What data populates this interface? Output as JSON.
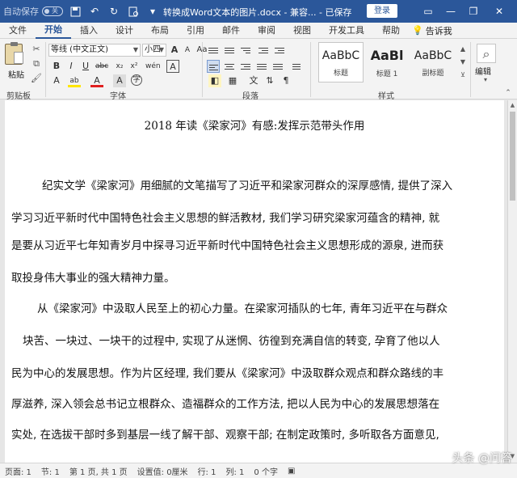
{
  "titlebar": {
    "autosave_label": "自动保存",
    "autosave_state": "关",
    "doc_title": "转换成Word文本的图片.docx  -  兼容...  -  已保存",
    "login_label": "登录",
    "minimize": "—",
    "restore": "❐",
    "close": "✕",
    "colors": {
      "bar": "#2b579a"
    }
  },
  "tabs": [
    "文件",
    "开始",
    "插入",
    "设计",
    "布局",
    "引用",
    "邮件",
    "审阅",
    "视图",
    "开发工具",
    "帮助"
  ],
  "tell_me": "告诉我",
  "ribbon": {
    "paste_label": "粘贴",
    "clipboard_label": "剪贴板",
    "font_name": "等线 (中文正文)",
    "font_size": "小四",
    "font_group_label": "字体",
    "paragraph_label": "段落",
    "styles_label": "样式",
    "edit_label": "编辑",
    "styles": [
      {
        "sample": "AaBbC",
        "name": "标题"
      },
      {
        "sample": "AaBl",
        "name": "标题 1"
      },
      {
        "sample": "AaBbC",
        "name": "副标题"
      }
    ],
    "font_buttons": {
      "bold": "B",
      "italic": "I",
      "underline": "U",
      "strike": "abc",
      "sub": "x₂",
      "sup": "x²",
      "font_color": "A",
      "highlight": "ab",
      "aa_grow": "A",
      "aa_shrink": "A",
      "case": "Aa",
      "phonetic": "wén",
      "border_char": "A"
    }
  },
  "document": {
    "title": "2018 年读《梁家河》有感:发挥示范带头作用",
    "lines": [
      "纪实文学《梁家河》用细腻的文笔描写了习近平和梁家河群众的深厚感情, 提供了深入",
      "学习习近平新时代中国特色社会主义思想的鲜活教材, 我们学习研究梁家河蕴含的精神, 就",
      "是要从习近平七年知青岁月中探寻习近平新时代中国特色社会主义思想形成的源泉, 进而获",
      "取投身伟大事业的强大精神力量。",
      "从《梁家河》中汲取人民至上的初心力量。在梁家河插队的七年, 青年习近平在与群众",
      "块苦、一块过、一块干的过程中, 实现了从迷惘、彷徨到充满自信的转变, 孕育了他以人",
      "民为中心的发展思想。作为片区经理, 我们要从《梁家河》中汲取群众观点和群众路线的丰",
      "厚滋养, 深入领会总书记立根群众、造福群众的工作方法, 把以人民为中心的发展思想落在",
      "实处, 在选拔干部时多到基层一线了解干部、观察干部; 在制定政策时, 多听取各方面意见,"
    ]
  },
  "status": {
    "page": "页面: 1",
    "section": "节: 1",
    "page_of": "第 1 页, 共 1 页",
    "setting": "设置值: 0厘米",
    "row": "行: 1",
    "col": "列: 1",
    "chars": "0 个字",
    "watermark": "头条 @问答"
  }
}
